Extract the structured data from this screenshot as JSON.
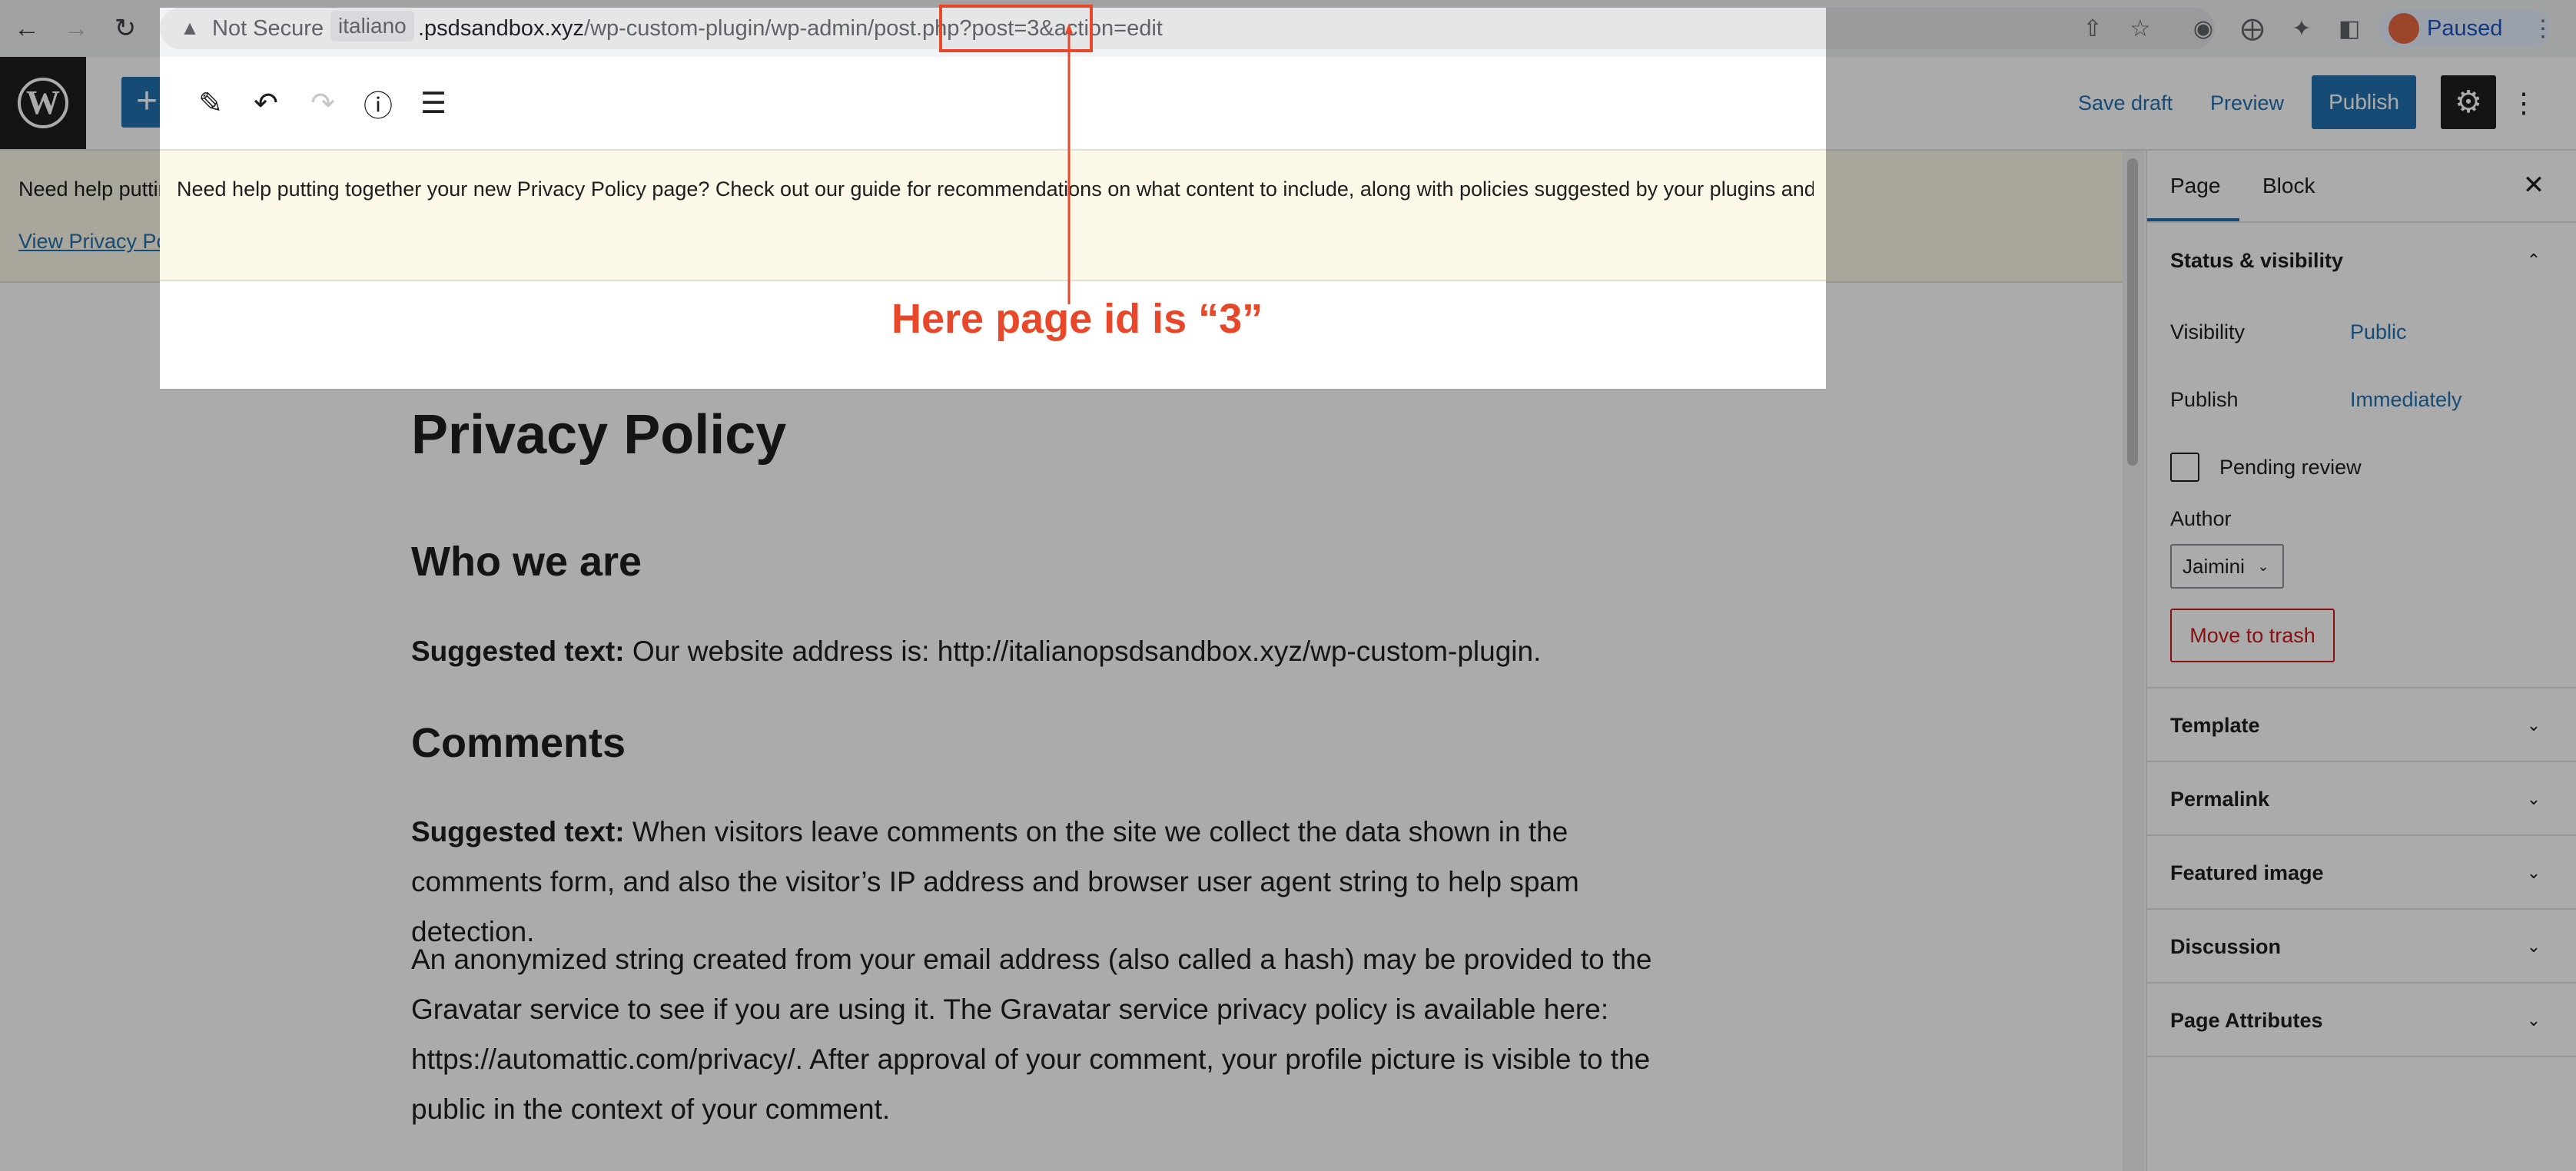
{
  "browser": {
    "security_label": "Not Secure",
    "host_chip": "italiano",
    "url_host": ".psdsandbox.xyz",
    "url_rest": "/wp-custom-plugin/wp-admin/post.php?post=3&action=edit",
    "profile_status": "Paused",
    "icons": [
      "back-arrow-icon",
      "forward-arrow-icon",
      "reload-icon",
      "warning-icon",
      "share-icon",
      "star-icon",
      "camera-icon",
      "google-lens-icon",
      "extensions-icon",
      "sidebar-icon",
      "kebab-icon"
    ]
  },
  "toolbar": {
    "add_block": "+",
    "save_draft": "Save draft",
    "preview": "Preview",
    "publish": "Publish"
  },
  "notice": {
    "text": "Need help putting together your new Privacy Policy page? Check out our guide for recommendations on what content to include, along with policies suggested by your plugins and theme.",
    "link": "View Privacy Policy Guide."
  },
  "editor": {
    "title": "Privacy Policy",
    "section1_heading": "Who we are",
    "section1_label": "Suggested text:",
    "section1_text": " Our website address is: http://italianopsdsandbox.xyz/wp-custom-plugin.",
    "section2_heading": "Comments",
    "section2_label": "Suggested text:",
    "section2_text": " When visitors leave comments on the site we collect the data shown in the comments form, and also the visitor’s IP address and browser user agent string to help spam detection.",
    "section2_para2": "An anonymized string created from your email address (also called a hash) may be provided to the Gravatar service to see if you are using it. The Gravatar service privacy policy is available here: https://automattic.com/privacy/. After approval of your comment, your profile picture is visible to the public in the context of your comment."
  },
  "sidebar": {
    "tab_page": "Page",
    "tab_block": "Block",
    "status_heading": "Status & visibility",
    "visibility_label": "Visibility",
    "visibility_value": "Public",
    "publish_label": "Publish",
    "publish_value": "Immediately",
    "pending_label": "Pending review",
    "pending_checked": false,
    "author_label": "Author",
    "author_value": "Jaimini",
    "trash": "Move to trash",
    "panels": [
      "Template",
      "Permalink",
      "Featured image",
      "Discussion",
      "Page Attributes"
    ]
  },
  "annotation": {
    "text": "Here page id is “3”",
    "color": "#e8472a"
  },
  "colors": {
    "wp_blue": "#2271b1",
    "notice_bg": "#fcf9e8",
    "trash_red": "#cc1818"
  }
}
